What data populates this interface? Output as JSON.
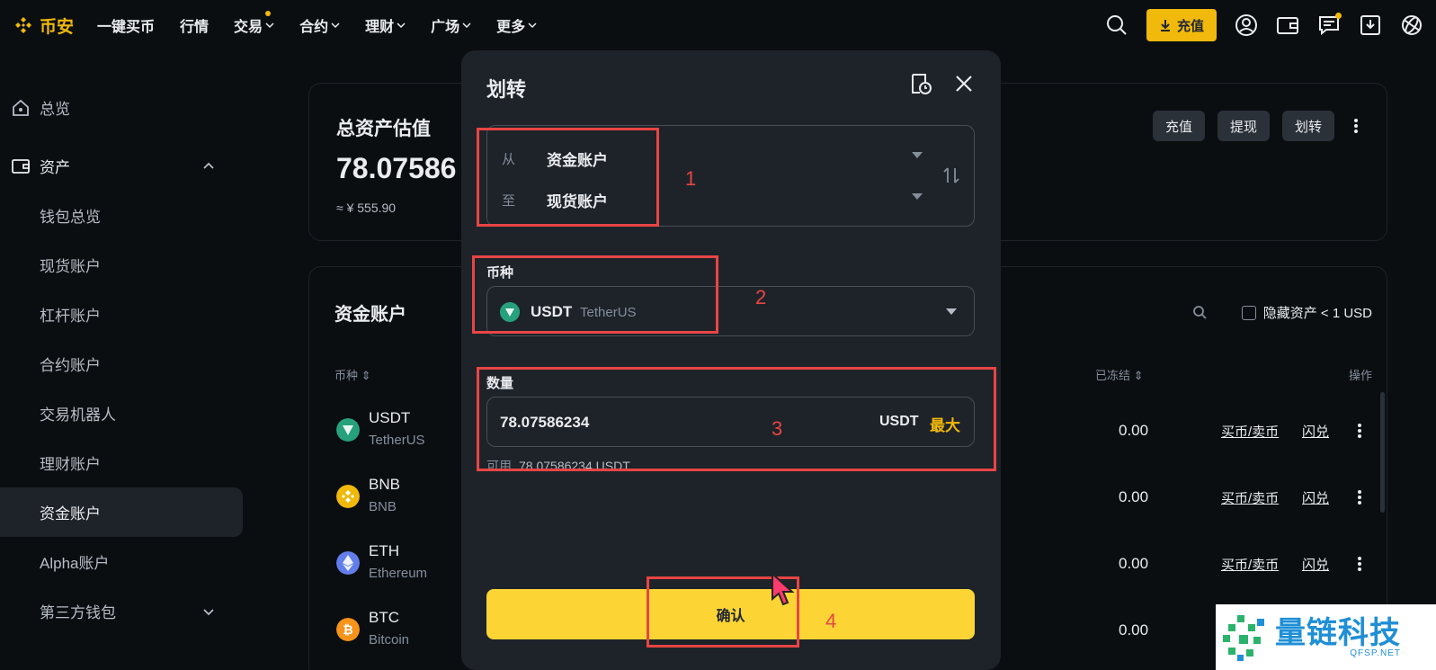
{
  "nav": {
    "brand": "币安",
    "items": [
      {
        "label": "一键买币",
        "chevron": false,
        "dot": false
      },
      {
        "label": "行情",
        "chevron": false,
        "dot": false
      },
      {
        "label": "交易",
        "chevron": true,
        "dot": true
      },
      {
        "label": "合约",
        "chevron": true,
        "dot": false
      },
      {
        "label": "理财",
        "chevron": true,
        "dot": false
      },
      {
        "label": "广场",
        "chevron": true,
        "dot": false
      },
      {
        "label": "更多",
        "chevron": true,
        "dot": false
      }
    ],
    "deposit_label": "充值"
  },
  "sidebar": {
    "overview": "总览",
    "assets": "资产",
    "items": [
      "钱包总览",
      "现货账户",
      "杠杆账户",
      "合约账户",
      "交易机器人",
      "理财账户",
      "资金账户",
      "Alpha账户",
      "第三方钱包"
    ],
    "active_index": 6
  },
  "balance_card": {
    "title": "总资产估值",
    "value": "78.07586",
    "cny": "≈ ¥ 555.90",
    "buttons": [
      "充值",
      "提现",
      "划转"
    ]
  },
  "funding_card": {
    "title": "资金账户",
    "hide_small_label": "隐藏资产 < 1 USD",
    "col_coin": "币种 ⇕",
    "col_frozen": "已冻结 ⇕",
    "col_actions": "操作",
    "rows": [
      {
        "symbol": "USDT",
        "name": "TetherUS",
        "frozen": "0.00",
        "act1": "买币/卖币",
        "act2": "闪兑",
        "color": "#26a17b"
      },
      {
        "symbol": "BNB",
        "name": "BNB",
        "frozen": "0.00",
        "act1": "买币/卖币",
        "act2": "闪兑",
        "color": "#f0b90b"
      },
      {
        "symbol": "ETH",
        "name": "Ethereum",
        "frozen": "0.00",
        "act1": "买币/卖币",
        "act2": "闪兑",
        "color": "#627eea"
      },
      {
        "symbol": "BTC",
        "name": "Bitcoin",
        "frozen": "0.00",
        "act1": "",
        "act2": "",
        "color": "#f7931a"
      }
    ]
  },
  "modal": {
    "title": "划转",
    "from_label": "从",
    "from_value": "资金账户",
    "to_label": "至",
    "to_value": "现货账户",
    "coin_label": "币种",
    "coin_symbol": "USDT",
    "coin_name": "TetherUS",
    "amount_label": "数量",
    "amount_value": "78.07586234",
    "amount_unit": "USDT",
    "max_label": "最大",
    "available_label": "可用",
    "available_value": "78.07586234 USDT",
    "confirm_label": "确认"
  },
  "annotations": [
    "1",
    "2",
    "3",
    "4"
  ],
  "watermark": {
    "cn": "量链科技",
    "en": "QFSP.NET"
  },
  "colors": {
    "accent": "#f0b90b",
    "button": "#fcd535",
    "annotation": "#e84545",
    "bg": "#0b0e11",
    "panel": "#1e2329"
  }
}
